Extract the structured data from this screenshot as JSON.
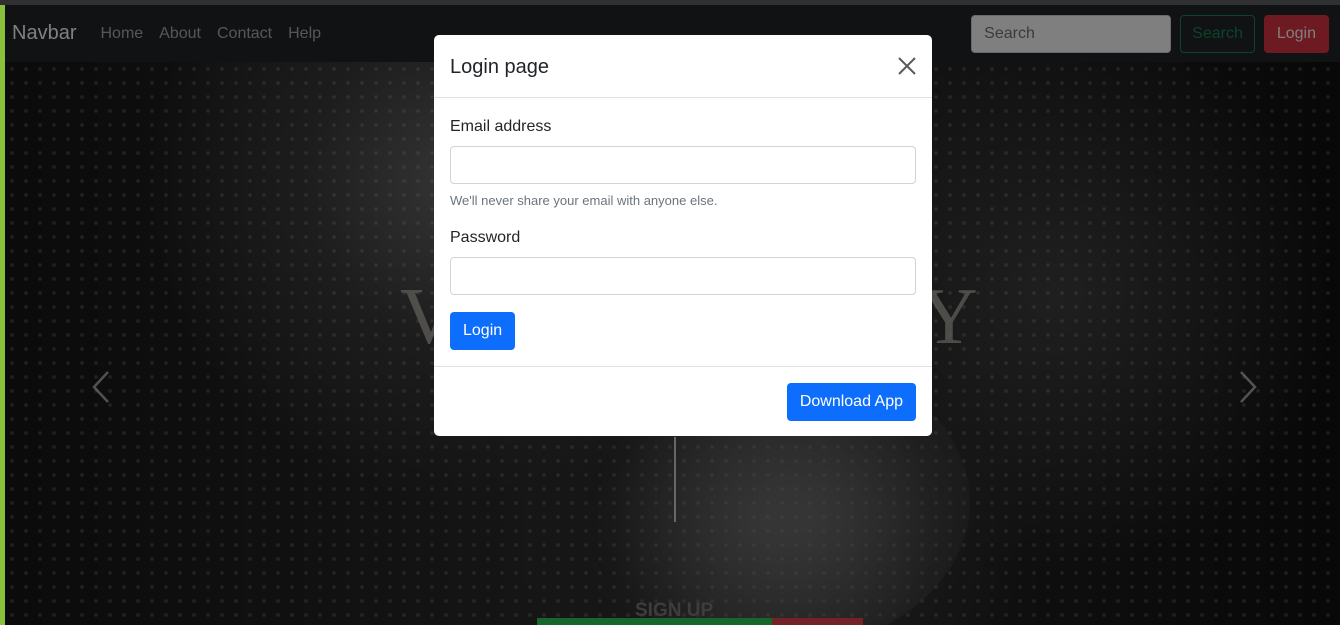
{
  "navbar": {
    "brand": "Navbar",
    "links": [
      "Home",
      "About",
      "Contact",
      "Help"
    ],
    "search_placeholder": "Search",
    "search_button": "Search",
    "login_button": "Login"
  },
  "hero": {
    "caption_title": "SIGN UP",
    "partial_word_left": "V",
    "partial_word_right": "Y"
  },
  "modal": {
    "title": "Login page",
    "email_label": "Email address",
    "email_help": "We'll never share your email with anyone else.",
    "password_label": "Password",
    "login_button": "Login",
    "download_button": "Download App"
  }
}
